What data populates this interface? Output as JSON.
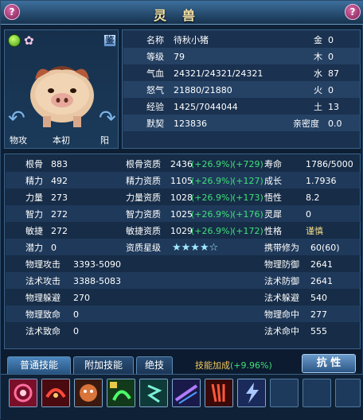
{
  "window": {
    "title": "灵兽",
    "left_button": "?",
    "right_button": "?"
  },
  "pet": {
    "appraise_label": "鉴",
    "bottom_left": "物攻",
    "bottom_center": "本初",
    "bottom_right": "阳"
  },
  "info": {
    "name_label": "名称",
    "name_value": "待秋小猪",
    "level_label": "等级",
    "level_value": "79",
    "hp_label": "气血",
    "hp_value": "24321/24321/24321",
    "rage_label": "怒气",
    "rage_value": "21880/21880",
    "exp_label": "经验",
    "exp_value": "1425/7044044",
    "bond_label": "默契",
    "bond_value": "123836",
    "elements": [
      {
        "label": "金",
        "value": "0"
      },
      {
        "label": "木",
        "value": "0"
      },
      {
        "label": "水",
        "value": "87"
      },
      {
        "label": "火",
        "value": "0"
      },
      {
        "label": "土",
        "value": "13"
      }
    ],
    "intimacy_label": "亲密度",
    "intimacy_value": "0.0"
  },
  "stats": {
    "rows": [
      {
        "a_label": "根骨",
        "a_value": "883",
        "b_label": "根骨资质",
        "b_value": "2436",
        "b_pct": "(+26.9%)",
        "b_add": "(+729)",
        "c_label": "寿命",
        "c_value": "1786/5000"
      },
      {
        "a_label": "精力",
        "a_value": "492",
        "b_label": "精力资质",
        "b_value": "1105",
        "b_pct": "(+26.9%)",
        "b_add": "(+127)",
        "c_label": "成长",
        "c_value": "1.7936"
      },
      {
        "a_label": "力量",
        "a_value": "273",
        "b_label": "力量资质",
        "b_value": "1028",
        "b_pct": "(+26.9%)",
        "b_add": "(+173)",
        "c_label": "悟性",
        "c_value": "8.2"
      },
      {
        "a_label": "智力",
        "a_value": "272",
        "b_label": "智力资质",
        "b_value": "1025",
        "b_pct": "(+26.9%)",
        "b_add": "(+176)",
        "c_label": "灵犀",
        "c_value": "0"
      },
      {
        "a_label": "敏捷",
        "a_value": "272",
        "b_label": "敏捷资质",
        "b_value": "1029",
        "b_pct": "(+26.9%)",
        "b_add": "(+172)",
        "c_label": "性格",
        "c_value": "谨慎"
      }
    ],
    "potential_label": "潜力",
    "potential_value": "0",
    "star_label": "资质星级",
    "stars": "★★★★☆",
    "carry_label": "携带修为",
    "carry_value": "60(60)",
    "combat": [
      {
        "l_label": "物理攻击",
        "l_value": "3393-5090",
        "r_label": "物理防御",
        "r_value": "2641"
      },
      {
        "l_label": "法术攻击",
        "l_value": "3388-5083",
        "r_label": "法术防御",
        "r_value": "2641"
      },
      {
        "l_label": "物理躲避",
        "l_value": "270",
        "r_label": "法术躲避",
        "r_value": "540"
      },
      {
        "l_label": "物理致命",
        "l_value": "0",
        "r_label": "物理命中",
        "r_value": "277"
      },
      {
        "l_label": "法术致命",
        "l_value": "0",
        "r_label": "法术命中",
        "r_value": "555"
      }
    ]
  },
  "tabs": [
    {
      "label": "普通技能"
    },
    {
      "label": "附加技能"
    },
    {
      "label": "绝技"
    }
  ],
  "skill_bonus_label": "技能加成",
  "skill_bonus_value": "(+9.96%)",
  "resist_button": "抗 性"
}
